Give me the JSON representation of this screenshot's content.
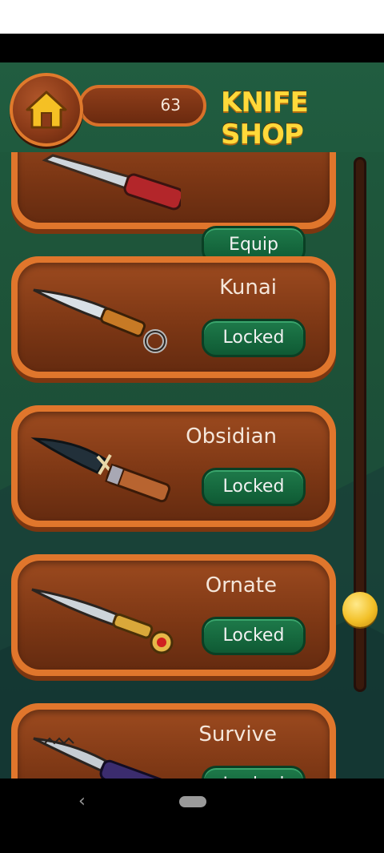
{
  "header": {
    "title": "KNIFE SHOP",
    "coins": "63",
    "home_icon": "home-icon"
  },
  "knives": [
    {
      "name": "",
      "button": "Equip"
    },
    {
      "name": "Kunai",
      "button": "Locked"
    },
    {
      "name": "Obsidian",
      "button": "Locked"
    },
    {
      "name": "Ornate",
      "button": "Locked"
    },
    {
      "name": "Survive",
      "button": "Locked"
    }
  ],
  "scroll": {
    "position": 0.87
  },
  "nav": {
    "back_icon": "‹"
  },
  "colors": {
    "background": "#1f5a3e",
    "card_border": "#e0762c",
    "card_fill": "#7b3614",
    "button_green": "#1e7a4a",
    "title_yellow": "#ffd93a",
    "scroll_thumb": "#f2c028"
  }
}
